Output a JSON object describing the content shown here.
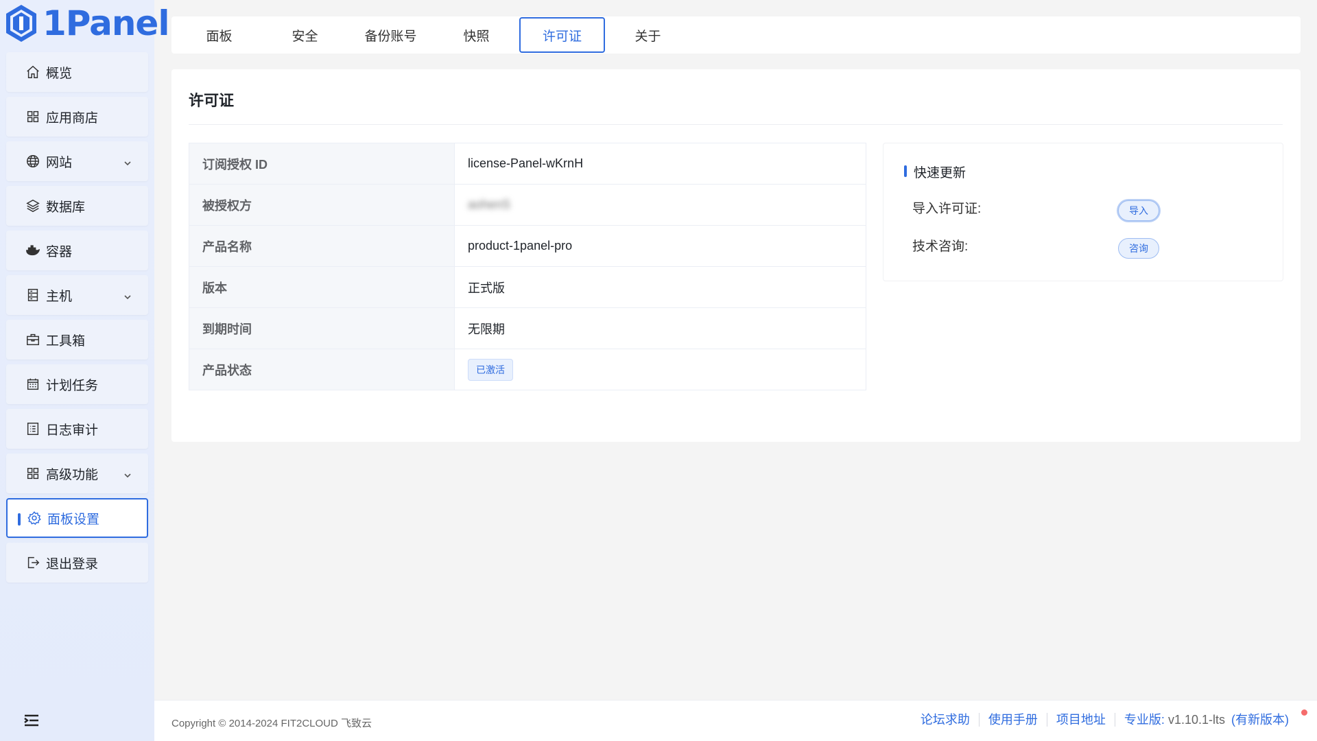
{
  "brand": {
    "name": "1Panel"
  },
  "sidebar": {
    "items": [
      {
        "label": "概览",
        "icon": "home-icon"
      },
      {
        "label": "应用商店",
        "icon": "grid-icon"
      },
      {
        "label": "网站",
        "icon": "globe-icon",
        "expandable": true
      },
      {
        "label": "数据库",
        "icon": "layers-icon"
      },
      {
        "label": "容器",
        "icon": "docker-icon"
      },
      {
        "label": "主机",
        "icon": "server-icon",
        "expandable": true
      },
      {
        "label": "工具箱",
        "icon": "toolbox-icon"
      },
      {
        "label": "计划任务",
        "icon": "calendar-icon"
      },
      {
        "label": "日志审计",
        "icon": "log-icon"
      },
      {
        "label": "高级功能",
        "icon": "grid-icon",
        "expandable": true
      },
      {
        "label": "面板设置",
        "icon": "gear-icon",
        "active": true
      },
      {
        "label": "退出登录",
        "icon": "logout-icon"
      }
    ]
  },
  "tabs": [
    {
      "label": "面板"
    },
    {
      "label": "安全"
    },
    {
      "label": "备份账号"
    },
    {
      "label": "快照"
    },
    {
      "label": "许可证",
      "active": true
    },
    {
      "label": "关于"
    }
  ],
  "license": {
    "title": "许可证",
    "rows": [
      {
        "label": "订阅授权 ID",
        "value": "license-Panel-wKrnH"
      },
      {
        "label": "被授权方",
        "value": "aohenS"
      },
      {
        "label": "产品名称",
        "value": "product-1panel-pro"
      },
      {
        "label": "版本",
        "value": "正式版"
      },
      {
        "label": "到期时间",
        "value": "无限期"
      },
      {
        "label": "产品状态",
        "value": "已激活"
      }
    ]
  },
  "quick_update": {
    "title": "快速更新",
    "import_label": "导入许可证:",
    "import_button": "导入",
    "consult_label": "技术咨询:",
    "consult_button": "咨询"
  },
  "footer": {
    "copyright": "Copyright © 2014-2024 FIT2CLOUD 飞致云",
    "links": [
      "论坛求助",
      "使用手册",
      "项目地址"
    ],
    "version_label": "专业版:",
    "version": "v1.10.1-lts",
    "new_version": "(有新版本)"
  },
  "colors": {
    "accent": "#2f6cdf",
    "status_dot": "#f56c6c"
  }
}
